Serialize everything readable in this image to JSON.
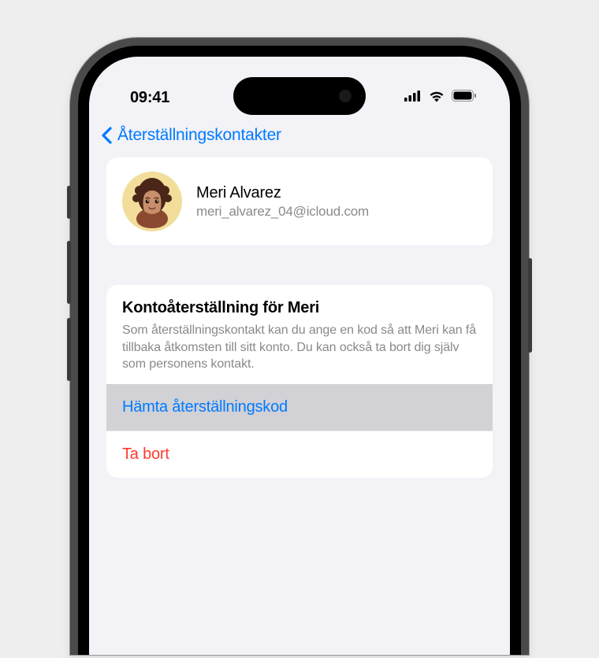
{
  "status_bar": {
    "time": "09:41"
  },
  "nav": {
    "back_label": "Återställningskontakter"
  },
  "contact": {
    "name": "Meri Alvarez",
    "email": "meri_alvarez_04@icloud.com"
  },
  "recovery": {
    "title": "Kontoåterställning för Meri",
    "description": "Som återställningskontakt kan du ange en kod så att Meri kan få tillbaka åtkomsten till sitt konto. Du kan också ta bort dig själv som personens kontakt.",
    "get_code_label": "Hämta återställningskod",
    "remove_label": "Ta bort"
  },
  "colors": {
    "tint": "#007aff",
    "destructive": "#ff3b30",
    "bg": "#f2f2f7"
  }
}
